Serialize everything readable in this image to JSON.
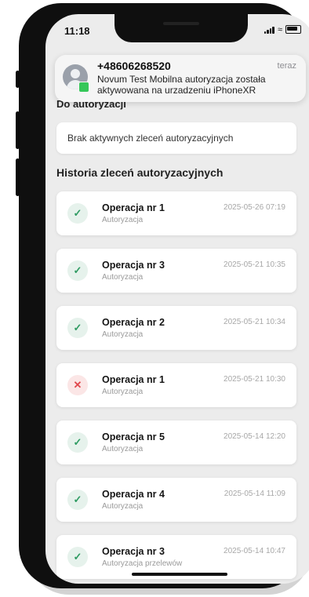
{
  "status_bar": {
    "time": "11:18"
  },
  "notification": {
    "title": "+48606268520",
    "time": "teraz",
    "body": "Novum Test Mobilna autoryzacja została aktywowana na urzadzeniu iPhoneXR"
  },
  "pending_section": {
    "title": "Do autoryzacji",
    "empty_text": "Brak aktywnych zleceń autoryzacyjnych"
  },
  "history_section": {
    "title": "Historia zleceń autoryzacyjnych",
    "items": [
      {
        "name": "Operacja nr 1",
        "subtitle": "Autoryzacja",
        "date": "2025-05-26 07:19",
        "status": "success"
      },
      {
        "name": "Operacja nr 3",
        "subtitle": "Autoryzacja",
        "date": "2025-05-21 10:35",
        "status": "success"
      },
      {
        "name": "Operacja nr 2",
        "subtitle": "Autoryzacja",
        "date": "2025-05-21 10:34",
        "status": "success"
      },
      {
        "name": "Operacja nr 1",
        "subtitle": "Autoryzacja",
        "date": "2025-05-21 10:30",
        "status": "rejected"
      },
      {
        "name": "Operacja nr 5",
        "subtitle": "Autoryzacja",
        "date": "2025-05-14 12:20",
        "status": "success"
      },
      {
        "name": "Operacja nr 4",
        "subtitle": "Autoryzacja",
        "date": "2025-05-14 11:09",
        "status": "success"
      },
      {
        "name": "Operacja nr 3",
        "subtitle": "Autoryzacja przelewów",
        "date": "2025-05-14 10:47",
        "status": "success"
      }
    ]
  },
  "icons": {
    "success": "check-icon",
    "rejected": "cross-icon",
    "success_color": "#2e9b62",
    "rejected_color": "#e0474c"
  }
}
